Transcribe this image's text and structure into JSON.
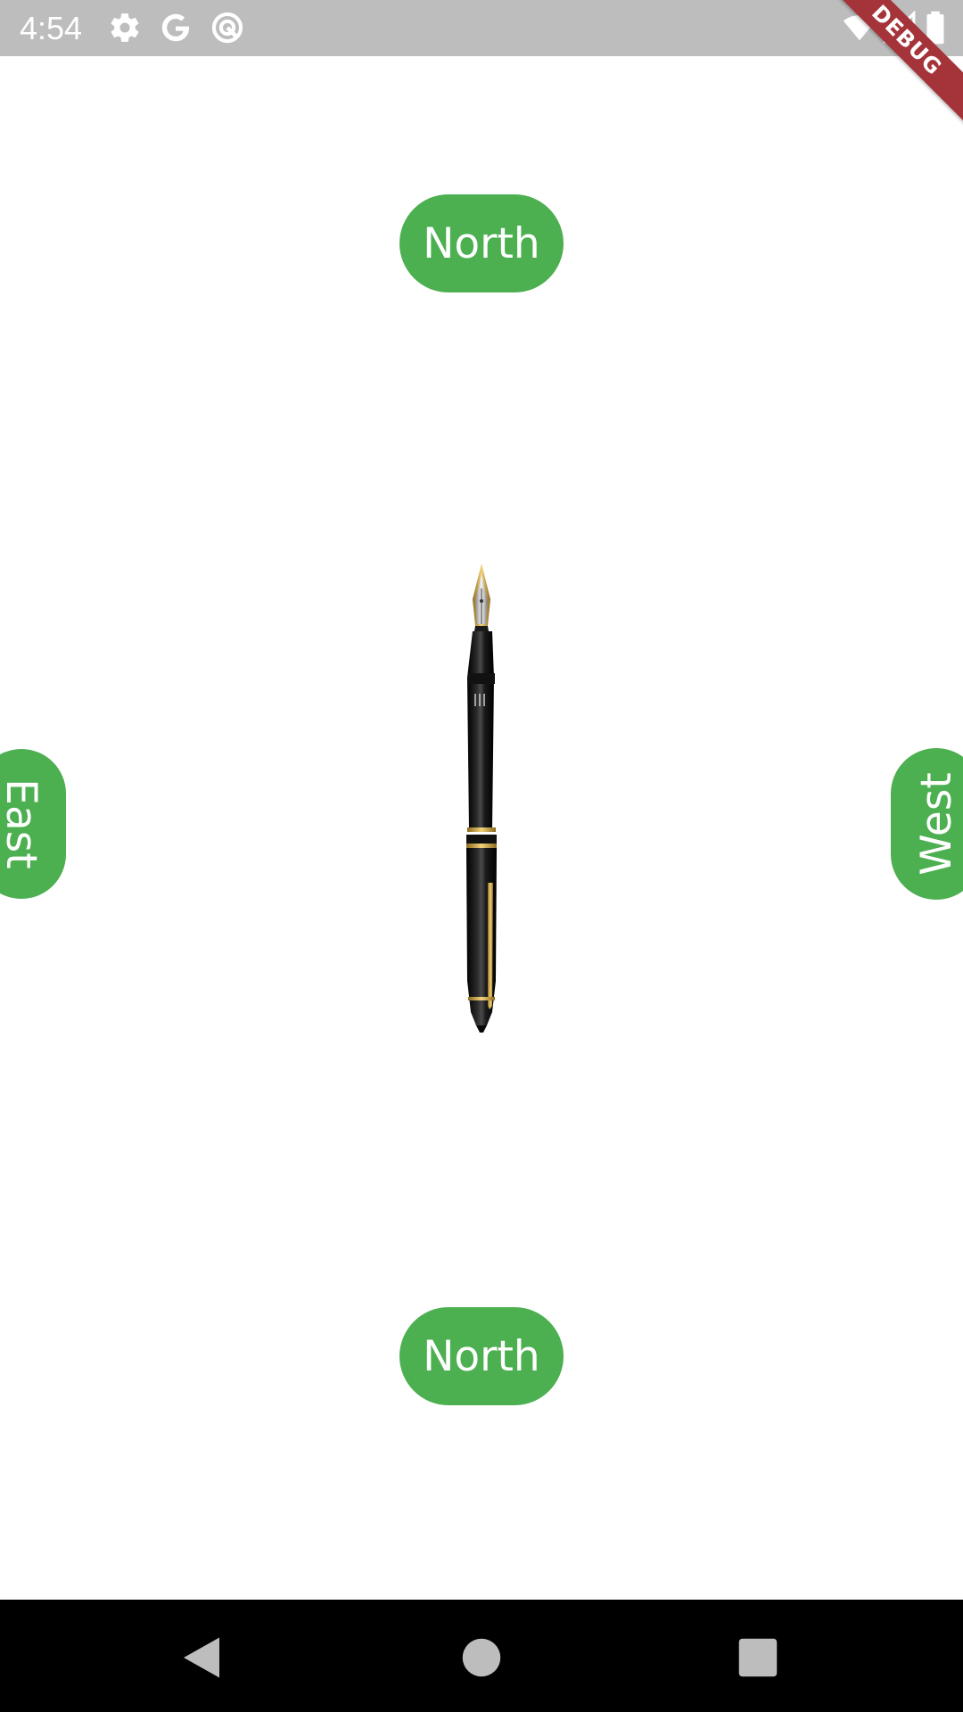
{
  "status_bar": {
    "time": "4:54",
    "background": "#bdbdbd",
    "left_icons": [
      "settings-icon",
      "google-icon",
      "sync-icon"
    ],
    "right_icons": [
      "wifi-icon",
      "signal-icon",
      "battery-icon"
    ]
  },
  "debug_banner": {
    "label": "DEBUG",
    "color": "#a5343a"
  },
  "compass": {
    "accent": "#4caf50",
    "top_label": "North",
    "bottom_label": "North",
    "left_label": "East",
    "right_label": "West",
    "center_image": "fountain-pen"
  },
  "nav_bar": {
    "buttons": [
      "back-icon",
      "home-icon",
      "recents-icon"
    ]
  }
}
